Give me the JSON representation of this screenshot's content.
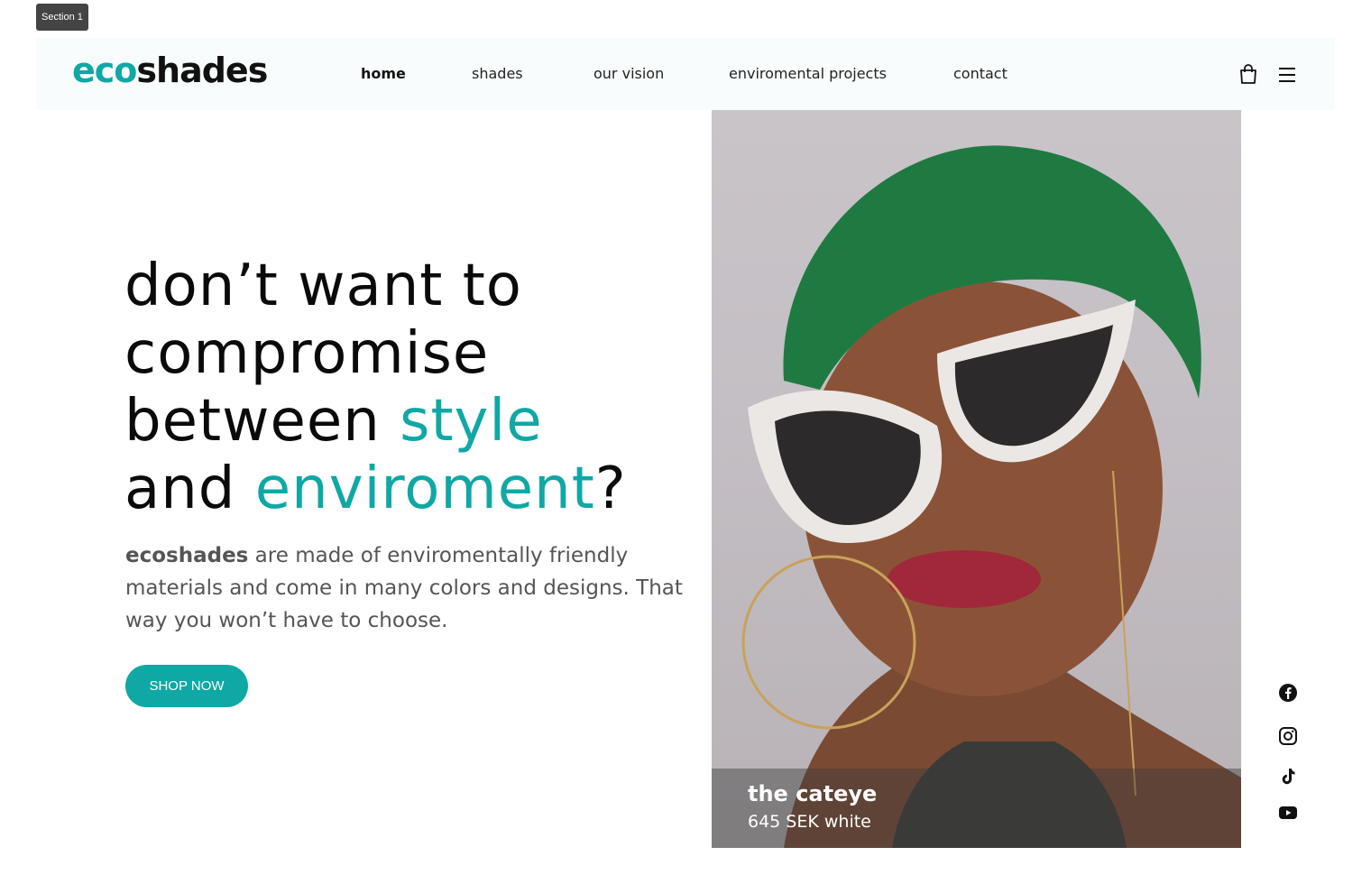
{
  "section_tag": "Section 1",
  "brand": {
    "eco": "eco",
    "shades": "shades",
    "accent_color": "#0fa8a4"
  },
  "nav": {
    "items": [
      {
        "label": "home",
        "active": true
      },
      {
        "label": "shades"
      },
      {
        "label": "our vision"
      },
      {
        "label": "enviromental projects"
      },
      {
        "label": "contact"
      }
    ],
    "icons": [
      "shopping-bag-icon",
      "hamburger-menu-icon"
    ]
  },
  "hero": {
    "line1": "don’t want to",
    "line2": "compromise",
    "line3_a": "between ",
    "line3_b": "style",
    "line4_a": "and ",
    "line4_b": "enviroment",
    "line4_c": "?",
    "lede_bold": "ecoshades",
    "lede_rest": " are made of enviromentally friendly materials and come in many colors and designs. That way you won’t have to choose.",
    "cta": "SHOP NOW"
  },
  "product": {
    "name": "the cateye",
    "detail": "645 SEK white"
  },
  "social": [
    "facebook-icon",
    "instagram-icon",
    "tiktok-icon",
    "youtube-icon"
  ]
}
